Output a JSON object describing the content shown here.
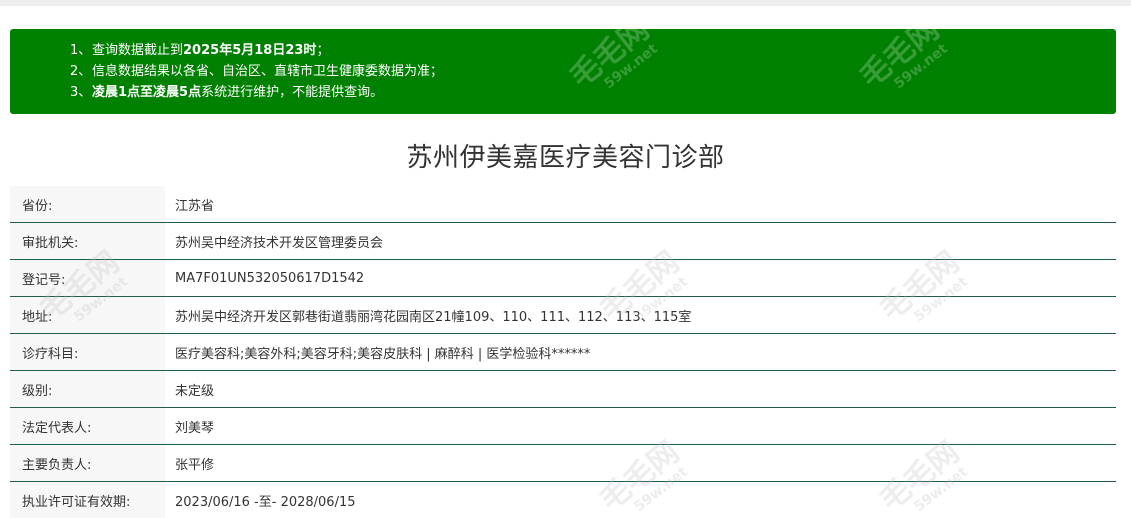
{
  "notice": {
    "lines": [
      {
        "num": "1、",
        "text_before": "查询数据截止到",
        "bold": "2025年5月18日23时",
        "text_after": "；"
      },
      {
        "num": "2、",
        "text_before": "信息数据结果以各省、自治区、直辖市卫生健康委数据为准；",
        "bold": "",
        "text_after": ""
      },
      {
        "num": "3、",
        "text_before": "",
        "bold": "凌晨1点至凌晨5点",
        "text_after": "系统进行维护，不能提供查询。"
      }
    ]
  },
  "title": "苏州伊美嘉医疗美容门诊部",
  "rows": [
    {
      "label": "省份:",
      "value": "江苏省"
    },
    {
      "label": "审批机关:",
      "value": "苏州吴中经济技术开发区管理委员会"
    },
    {
      "label": "登记号:",
      "value": "MA7F01UN532050617D1542"
    },
    {
      "label": "地址:",
      "value": "苏州吴中经济开发区郭巷街道翡丽湾花园南区21幢109、110、111、112、113、115室"
    },
    {
      "label": "诊疗科目:",
      "value": "医疗美容科;美容外科;美容牙科;美容皮肤科 | 麻醉科 | 医学检验科******"
    },
    {
      "label": "级别:",
      "value": "未定级"
    },
    {
      "label": "法定代表人:",
      "value": "刘美琴"
    },
    {
      "label": "主要负责人:",
      "value": "张平修"
    },
    {
      "label": "执业许可证有效期:",
      "value": "2023/06/16 -至- 2028/06/15"
    }
  ],
  "watermark": {
    "main": "毛毛网",
    "sub": "59w.net"
  },
  "colors": {
    "notice_bg": "#008000",
    "row_border": "#1f5e4a",
    "label_bg": "#f7f7f7"
  }
}
